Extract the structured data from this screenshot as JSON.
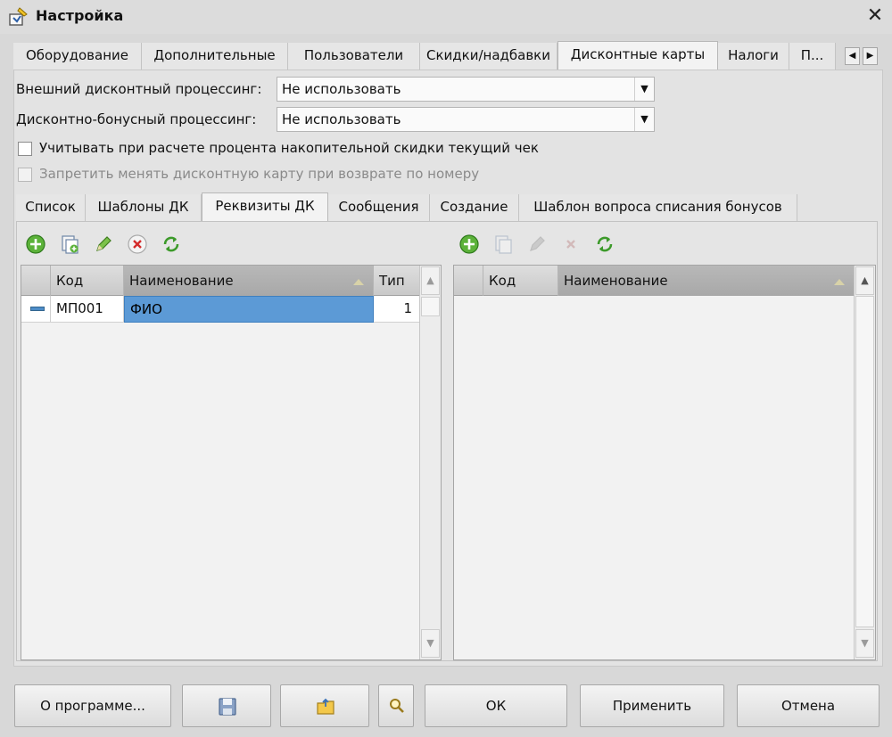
{
  "window": {
    "title": "Настройка"
  },
  "outer_tabs": [
    "Оборудование",
    "Дополнительные",
    "Пользователи",
    "Скидки/надбавки",
    "Дисконтные карты",
    "Налоги",
    "П..."
  ],
  "form": {
    "external_label": "Внешний дисконтный процессинг:",
    "external_value": "Не использовать",
    "bonus_label": "Дисконтно-бонусный процессинг:",
    "bonus_value": "Не использовать",
    "check1_label": "Учитывать при расчете процента накопительной скидки текущий чек",
    "check2_label": "Запретить менять дисконтную карту при возврате по номеру"
  },
  "inner_tabs": [
    "Список",
    "Шаблоны ДК",
    "Реквизиты ДК",
    "Сообщения",
    "Создание",
    "Шаблон вопроса списания бонусов"
  ],
  "left_grid": {
    "columns": [
      "Код",
      "Наименование",
      "Тип"
    ],
    "rows": [
      {
        "code": "МП001",
        "name": "ФИО",
        "type": "1"
      }
    ]
  },
  "right_grid": {
    "columns": [
      "Код",
      "Наименование"
    ],
    "rows": []
  },
  "buttons": {
    "about": "О программе...",
    "ok": "ОК",
    "apply": "Применить",
    "cancel": "Отмена"
  },
  "icons": {
    "add": "add-icon",
    "copy": "copy-icon",
    "edit": "edit-icon",
    "delete": "delete-icon",
    "refresh": "refresh-icon",
    "save": "save-icon",
    "open": "open-folder-icon",
    "search": "search-icon"
  }
}
